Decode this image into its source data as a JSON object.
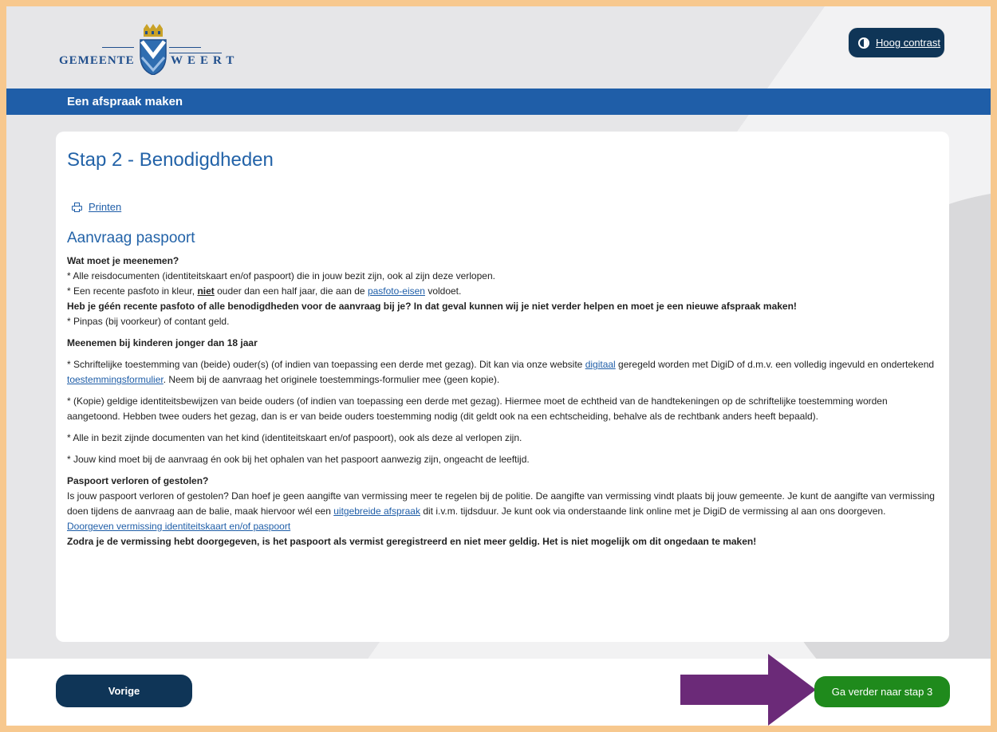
{
  "header": {
    "logo_left": "GEMEENTE",
    "logo_right": "WEERT",
    "contrast_label": "Hoog contrast"
  },
  "bluebar": {
    "title": "Een afspraak maken"
  },
  "card": {
    "heading": "Stap 2 - Benodigdheden",
    "print_label": "Printen",
    "subheading": "Aanvraag paspoort"
  },
  "content": {
    "q1": "Wat moet je meenemen?",
    "l1": "* Alle reisdocumenten (identiteitskaart en/of paspoort) die in jouw bezit zijn, ook al zijn deze verlopen.",
    "l2a": "* Een recente pasfoto in kleur, ",
    "l2b": "niet",
    "l2c": " ouder dan een half jaar, die aan de ",
    "l2link": "pasfoto-eisen",
    "l2d": " voldoet.",
    "l3": "Heb je géén recente pasfoto of alle benodigdheden voor de aanvraag bij je? In dat geval kunnen wij je niet verder helpen en moet je een nieuwe afspraak maken!",
    "l4": "* Pinpas (bij voorkeur) of contant geld.",
    "q2": "Meenemen bij kinderen jonger dan 18 jaar",
    "k1a": "* Schriftelijke toestemming van (beide) ouder(s) (of indien van toepassing een derde met gezag). Dit kan via onze website ",
    "k1link1": "digitaal",
    "k1b": " geregeld worden met DigiD of d.m.v. een volledig ingevuld en ondertekend ",
    "k1link2": "toestemmingsformulier",
    "k1c": ". Neem bij de aanvraag het originele toestemmings-formulier mee (geen kopie).",
    "k2": "* (Kopie) geldige identiteitsbewijzen van beide ouders (of indien van toepassing een derde met gezag). Hiermee moet de echtheid van de handtekeningen op de schriftelijke toestemming worden aangetoond. Hebben twee ouders het gezag, dan is er van beide ouders toestemming nodig (dit geldt ook na een echtscheiding, behalve als de rechtbank anders heeft bepaald).",
    "k3": "* Alle in bezit zijnde documenten van het kind (identiteitskaart en/of paspoort), ook als deze al verlopen zijn.",
    "k4": "*  Jouw kind moet bij de aanvraag én ook bij het ophalen van het paspoort aanwezig zijn, ongeacht de leeftijd.",
    "q3": "Paspoort verloren of gestolen?",
    "v1a": "Is jouw paspoort verloren of gestolen? Dan hoef je geen aangifte van vermissing meer te regelen bij de politie. De aangifte van vermissing vindt plaats bij jouw gemeente. Je kunt de aangifte van vermissing doen tijdens de aanvraag aan de balie, maak hiervoor wél een ",
    "v1link": "uitgebreide afspraak",
    "v1b": " dit i.v.m. tijdsduur. Je kunt ook via onderstaande link online met je DigiD de vermissing al aan ons doorgeven.",
    "v2link": "Doorgeven vermissing identiteitskaart en/of paspoort",
    "v3": "Zodra je de vermissing hebt doorgegeven, is het paspoort als vermist geregistreerd en niet meer geldig. Het is niet mogelijk om dit ongedaan te maken!"
  },
  "footer": {
    "prev_label": "Vorige",
    "next_label": "Ga verder naar stap 3"
  },
  "colors": {
    "accent_blue": "#1f5ea8",
    "dark_navy": "#0f3557",
    "next_green": "#1f8a1c",
    "arrow_purple": "#6b2a78",
    "frame_orange": "#f7c88e"
  }
}
